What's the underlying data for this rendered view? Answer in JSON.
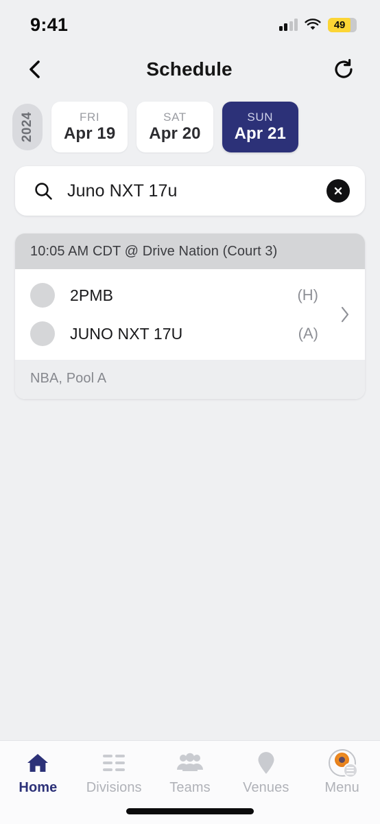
{
  "status_bar": {
    "time": "9:41",
    "signal_icon": "cellular-signal-icon",
    "signal_bars_filled": 2,
    "wifi_icon": "wifi-icon",
    "battery_level": "49",
    "battery_icon": "battery-low-power-icon",
    "battery_color": "#fcd535"
  },
  "nav": {
    "back_icon": "chevron-left-icon",
    "title": "Schedule",
    "refresh_icon": "refresh-icon"
  },
  "date_strip": {
    "year": "2024",
    "dates": [
      {
        "dow": "FRI",
        "date": "Apr 19",
        "selected": false
      },
      {
        "dow": "SAT",
        "date": "Apr 20",
        "selected": false
      },
      {
        "dow": "SUN",
        "date": "Apr 21",
        "selected": true
      }
    ]
  },
  "search": {
    "icon": "search-icon",
    "value": "Juno NXT 17u",
    "placeholder": "Search",
    "clear_icon": "clear-circle-icon"
  },
  "games": [
    {
      "header": "10:05 AM CDT @ Drive Nation (Court 3)",
      "teams": [
        {
          "name": "2PMB",
          "side": "(H)",
          "avatar": "team-avatar"
        },
        {
          "name": "JUNO NXT 17U",
          "side": "(A)",
          "avatar": "team-avatar"
        }
      ],
      "footer": "NBA, Pool A",
      "chevron_icon": "chevron-right-icon"
    }
  ],
  "tabs": [
    {
      "label": "Home",
      "icon": "home-icon",
      "active": true
    },
    {
      "label": "Divisions",
      "icon": "divisions-grid-icon",
      "active": false
    },
    {
      "label": "Teams",
      "icon": "teams-people-icon",
      "active": false
    },
    {
      "label": "Venues",
      "icon": "venue-pin-icon",
      "active": false
    },
    {
      "label": "Menu",
      "icon": "menu-avatar-icon",
      "active": false
    }
  ],
  "colors": {
    "accent_navy": "#2c3178",
    "page_background": "#eff0f2",
    "card_header_gray": "#d4d5d7"
  }
}
